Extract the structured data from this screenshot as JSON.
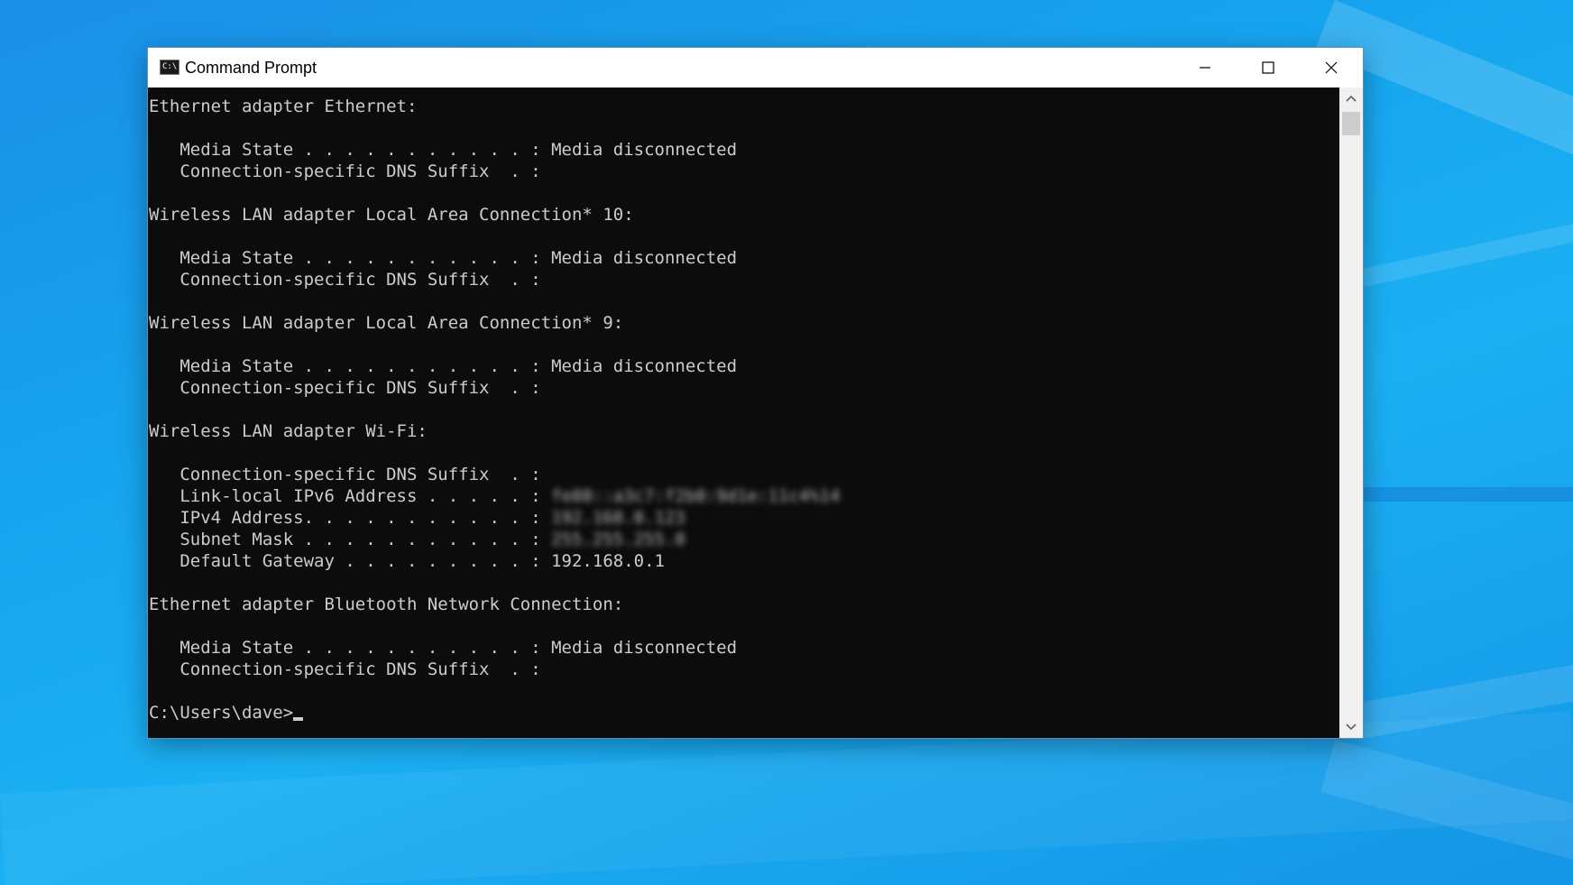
{
  "window": {
    "title": "Command Prompt",
    "icon_label": "C:\\.",
    "controls": {
      "minimize": "minimize-icon",
      "maximize": "maximize-icon",
      "close": "close-icon"
    }
  },
  "console": {
    "lines": [
      {
        "text": "Ethernet adapter Ethernet:"
      },
      {
        "text": ""
      },
      {
        "text": "   Media State . . . . . . . . . . . : Media disconnected"
      },
      {
        "text": "   Connection-specific DNS Suffix  . :"
      },
      {
        "text": ""
      },
      {
        "text": "Wireless LAN adapter Local Area Connection* 10:"
      },
      {
        "text": ""
      },
      {
        "text": "   Media State . . . . . . . . . . . : Media disconnected"
      },
      {
        "text": "   Connection-specific DNS Suffix  . :"
      },
      {
        "text": ""
      },
      {
        "text": "Wireless LAN adapter Local Area Connection* 9:"
      },
      {
        "text": ""
      },
      {
        "text": "   Media State . . . . . . . . . . . : Media disconnected"
      },
      {
        "text": "   Connection-specific DNS Suffix  . :"
      },
      {
        "text": ""
      },
      {
        "text": "Wireless LAN adapter Wi-Fi:"
      },
      {
        "text": ""
      },
      {
        "text": "   Connection-specific DNS Suffix  . :"
      },
      {
        "text": "   Link-local IPv6 Address . . . . . : ",
        "redacted": "fe80::a3c7:f2b0:9d1e:11c4%14"
      },
      {
        "text": "   IPv4 Address. . . . . . . . . . . : ",
        "redacted": "192.168.0.123"
      },
      {
        "text": "   Subnet Mask . . . . . . . . . . . : ",
        "redacted": "255.255.255.0"
      },
      {
        "text": "   Default Gateway . . . . . . . . . : 192.168.0.1"
      },
      {
        "text": ""
      },
      {
        "text": "Ethernet adapter Bluetooth Network Connection:"
      },
      {
        "text": ""
      },
      {
        "text": "   Media State . . . . . . . . . . . : Media disconnected"
      },
      {
        "text": "   Connection-specific DNS Suffix  . :"
      },
      {
        "text": ""
      },
      {
        "text": "C:\\Users\\dave>",
        "cursor": true
      }
    ]
  },
  "scrollbar": {
    "up": "chevron-up-icon",
    "down": "chevron-down-icon",
    "position": 0.0
  },
  "colors": {
    "console_bg": "#0c0c0c",
    "console_fg": "#cccccc",
    "titlebar_bg": "#ffffff",
    "desktop_accent": "#1aa3ee"
  }
}
